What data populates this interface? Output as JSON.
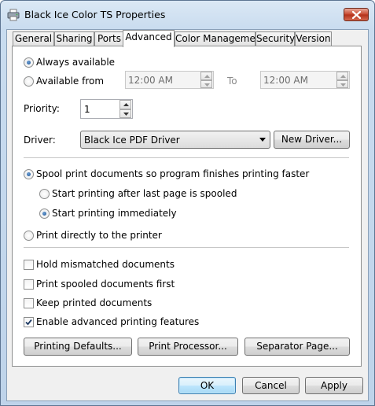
{
  "window": {
    "title": "Black Ice Color TS Properties",
    "close_label": "close"
  },
  "tabs": [
    {
      "label": "General"
    },
    {
      "label": "Sharing"
    },
    {
      "label": "Ports"
    },
    {
      "label": "Advanced"
    },
    {
      "label": "Color Management"
    },
    {
      "label": "Security"
    },
    {
      "label": "Version"
    }
  ],
  "active_tab": "Advanced",
  "availability": {
    "always_label": "Always available",
    "always_selected": true,
    "from_label": "Available from",
    "from_selected": false,
    "from_time": "12:00 AM",
    "to_label": "To",
    "to_time": "12:00 AM"
  },
  "priority": {
    "label": "Priority:",
    "value": "1"
  },
  "driver": {
    "label": "Driver:",
    "selected": "Black Ice PDF Driver",
    "new_driver_button": "New Driver..."
  },
  "spool": {
    "spool_label": "Spool print documents so program finishes printing faster",
    "spool_selected": true,
    "after_last_label": "Start printing after last page is spooled",
    "after_last_selected": false,
    "immediately_label": "Start printing immediately",
    "immediately_selected": true,
    "direct_label": "Print directly to the printer",
    "direct_selected": false
  },
  "options": {
    "hold_mismatched": {
      "label": "Hold mismatched documents",
      "checked": false
    },
    "print_spooled_first": {
      "label": "Print spooled documents first",
      "checked": false
    },
    "keep_printed": {
      "label": "Keep printed documents",
      "checked": false
    },
    "enable_advanced": {
      "label": "Enable advanced printing features",
      "checked": true
    }
  },
  "buttons": {
    "printing_defaults": "Printing Defaults...",
    "print_processor": "Print Processor...",
    "separator_page": "Separator Page...",
    "ok": "OK",
    "cancel": "Cancel",
    "apply": "Apply"
  }
}
